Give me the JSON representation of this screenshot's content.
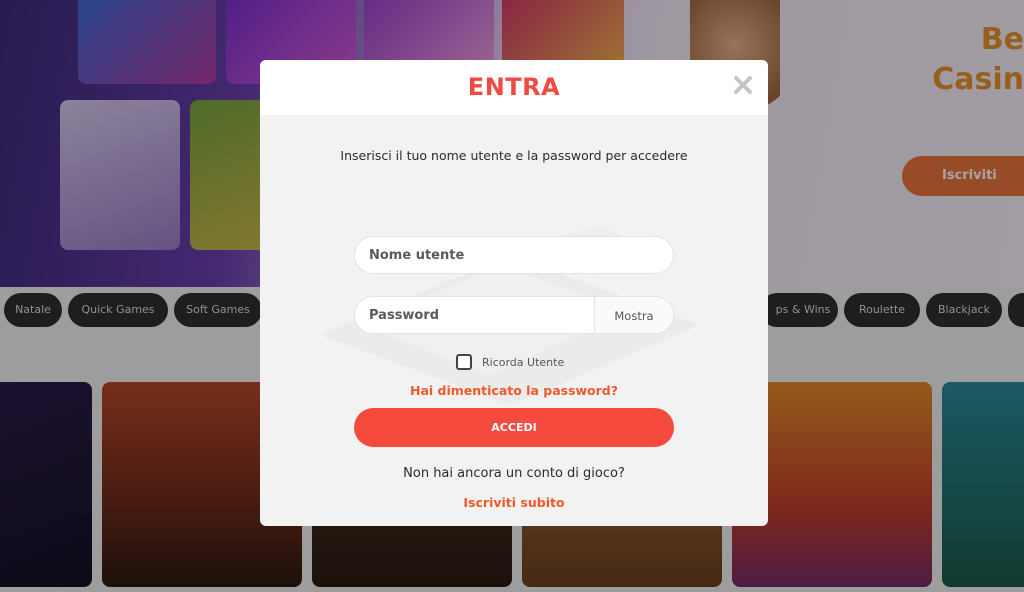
{
  "background": {
    "hero_title": "Be Casin",
    "hero_button": "Iscriviti",
    "chips": [
      "Natale",
      "Quick Games",
      "Soft Games",
      "ps & Wins",
      "Roulette",
      "Blackjack"
    ]
  },
  "modal": {
    "title": "ENTRA",
    "intro": "Inserisci il tuo nome utente e la password per accedere",
    "username_placeholder": "Nome utente",
    "password_placeholder": "Password",
    "show_label": "Mostra",
    "remember_label": "Ricorda Utente",
    "forgot_label": "Hai dimenticato la password?",
    "login_label": "ACCEDI",
    "no_account_text": "Non hai ancora un conto di gioco?",
    "signup_label": "Iscriviti subito"
  },
  "colors": {
    "accent_red": "#f04b43",
    "link_orange": "#ef5a2d",
    "button_red": "#f74a3f"
  }
}
